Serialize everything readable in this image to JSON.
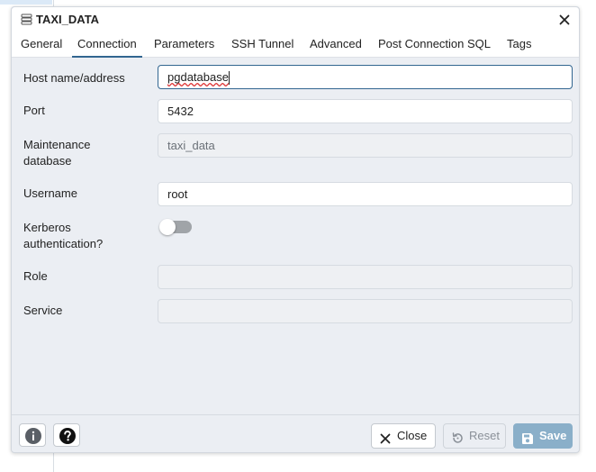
{
  "dialog": {
    "title": "TAXI_DATA"
  },
  "tabs": [
    {
      "label": "General"
    },
    {
      "label": "Connection"
    },
    {
      "label": "Parameters"
    },
    {
      "label": "SSH Tunnel"
    },
    {
      "label": "Advanced"
    },
    {
      "label": "Post Connection SQL"
    },
    {
      "label": "Tags"
    }
  ],
  "active_tab": "Connection",
  "form": {
    "host": {
      "label": "Host name/address",
      "value": "pgdatabase"
    },
    "port": {
      "label": "Port",
      "value": "5432"
    },
    "maintenance_db": {
      "label_line1": "Maintenance",
      "label_line2": "database",
      "value": "taxi_data"
    },
    "username": {
      "label": "Username",
      "value": "root"
    },
    "kerberos": {
      "label_line1": "Kerberos",
      "label_line2": "authentication?",
      "enabled": false
    },
    "role": {
      "label": "Role",
      "value": ""
    },
    "service": {
      "label": "Service",
      "value": ""
    }
  },
  "footer": {
    "close_label": "Close",
    "reset_label": "Reset",
    "save_label": "Save"
  },
  "colors": {
    "accent": "#326690",
    "save_button": "#8aafc9",
    "dialog_bg": "#ebeef3"
  }
}
